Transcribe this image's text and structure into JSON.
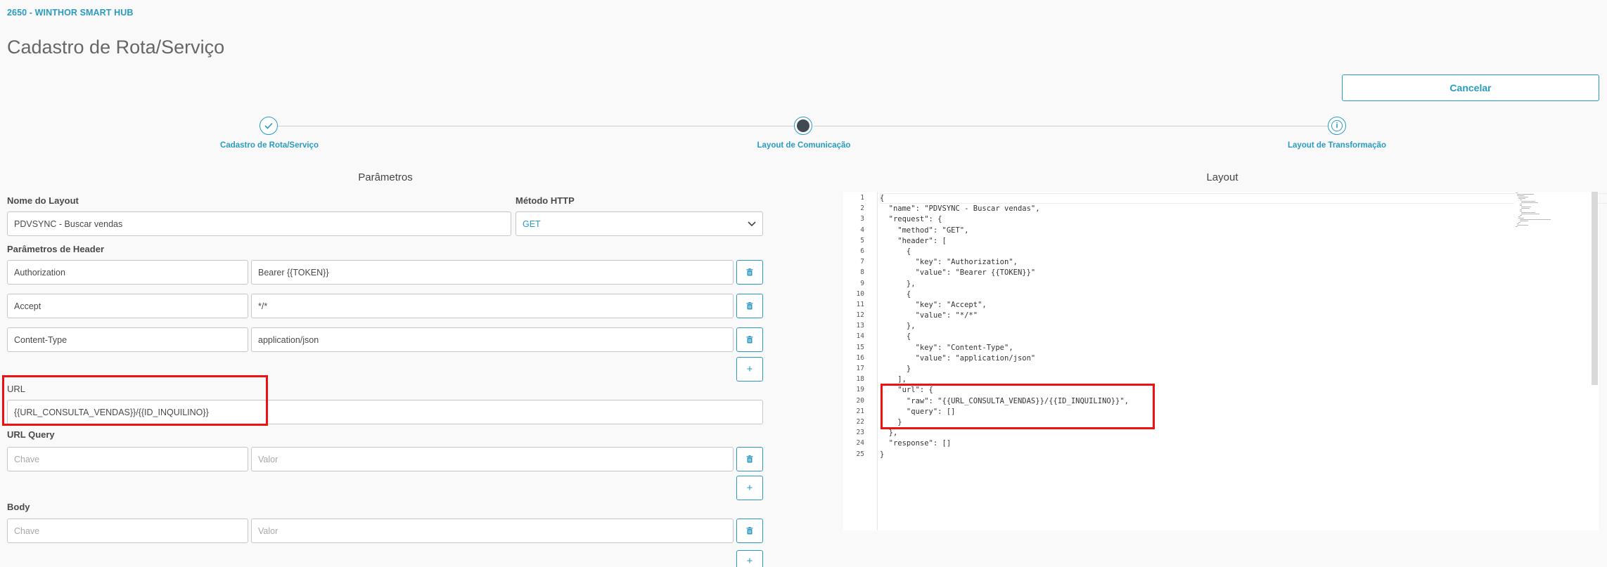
{
  "header": {
    "app_code": "2650 - WINTHOR SMART HUB",
    "page_title": "Cadastro de Rota/Serviço",
    "cancel_label": "Cancelar"
  },
  "stepper": {
    "steps": [
      {
        "label": "Cadastro de Rota/Serviço",
        "state": "done"
      },
      {
        "label": "Layout de Comunicação",
        "state": "current"
      },
      {
        "label": "Layout de Transformação",
        "state": "info"
      }
    ]
  },
  "parameters": {
    "section_title": "Parâmetros",
    "layout_name_label": "Nome do Layout",
    "layout_name_value": "PDVSYNC - Buscar vendas",
    "http_method_label": "Método HTTP",
    "http_method_value": "GET",
    "header_params_label": "Parâmetros de Header",
    "headers": [
      {
        "key": "Authorization",
        "value": "Bearer {{TOKEN}}"
      },
      {
        "key": "Accept",
        "value": "*/*"
      },
      {
        "key": "Content-Type",
        "value": "application/json"
      }
    ],
    "url_label": "URL",
    "url_value": "{{URL_CONSULTA_VENDAS}}/{{ID_INQUILINO}}",
    "url_query_label": "URL Query",
    "url_query_key_placeholder": "Chave",
    "url_query_value_placeholder": "Valor",
    "body_label": "Body",
    "body_key_placeholder": "Chave",
    "body_value_placeholder": "Valor"
  },
  "layout": {
    "section_title": "Layout",
    "lines": [
      "{",
      "  \"name\": \"PDVSYNC - Buscar vendas\",",
      "  \"request\": {",
      "    \"method\": \"GET\",",
      "    \"header\": [",
      "      {",
      "        \"key\": \"Authorization\",",
      "        \"value\": \"Bearer {{TOKEN}}\"",
      "      },",
      "      {",
      "        \"key\": \"Accept\",",
      "        \"value\": \"*/*\"",
      "      },",
      "      {",
      "        \"key\": \"Content-Type\",",
      "        \"value\": \"application/json\"",
      "      }",
      "    ],",
      "    \"url\": {",
      "      \"raw\": \"{{URL_CONSULTA_VENDAS}}/{{ID_INQUILINO}}\",",
      "      \"query\": []",
      "    }",
      "  },",
      "  \"response\": []",
      "}"
    ],
    "line_numbers": [
      "1",
      "2",
      "3",
      "4",
      "5",
      "6",
      "7",
      "8",
      "9",
      "10",
      "11",
      "12",
      "13",
      "14",
      "15",
      "16",
      "17",
      "18",
      "19",
      "20",
      "21",
      "22",
      "23",
      "24",
      "25"
    ]
  },
  "colors": {
    "accent": "#2a9bbf",
    "highlight": "#ef1010",
    "step_current": "#3f4a52"
  }
}
